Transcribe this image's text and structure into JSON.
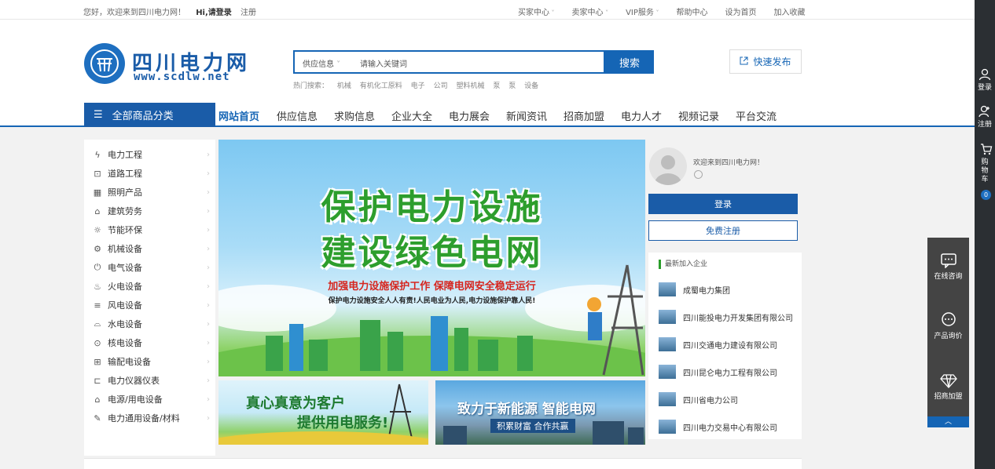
{
  "topbar": {
    "greeting": "您好，欢迎来到四川电力网！",
    "login_prompt": "Hi,请登录",
    "register": "注册",
    "links": [
      "买家中心",
      "卖家中心",
      "VIP服务",
      "帮助中心",
      "设为首页",
      "加入收藏"
    ]
  },
  "logo": {
    "name": "四川电力网",
    "url": "www.scdlw.net"
  },
  "search": {
    "category": "供应信息",
    "placeholder": "请输入关键词",
    "button": "搜索",
    "hot_label": "热门搜索：",
    "hot_terms": [
      "机械",
      "有机化工原料",
      "电子",
      "公司",
      "塑料机械",
      "泵",
      "泵",
      "设备"
    ]
  },
  "publish_button": "快速发布",
  "nav": {
    "all_categories": "全部商品分类",
    "items": [
      "网站首页",
      "供应信息",
      "求购信息",
      "企业大全",
      "电力展会",
      "新闻资讯",
      "招商加盟",
      "电力人才",
      "视频记录",
      "平台交流"
    ]
  },
  "categories": [
    "电力工程",
    "道路工程",
    "照明产品",
    "建筑劳务",
    "节能环保",
    "机械设备",
    "电气设备",
    "火电设备",
    "风电设备",
    "水电设备",
    "核电设备",
    "输配电设备",
    "电力仪器仪表",
    "电源/用电设备",
    "电力通用设备/材料"
  ],
  "banner_main": {
    "line1": "保护电力设施",
    "line2": "建设绿色电网",
    "line3": "加强电力设施保护工作 保障电网安全稳定运行",
    "line4": "保护电力设施安全人人有责!人民电业为人民,电力设施保护靠人民!"
  },
  "banner_small1": {
    "line1": "真心真意为客户",
    "line2": "提供用电服务!"
  },
  "banner_small2": {
    "line1": "致力于新能源  智能电网",
    "line2": "积累财富 合作共赢"
  },
  "user_panel": {
    "welcome": "欢迎来到四川电力网！",
    "login": "登录",
    "register": "免费注册"
  },
  "new_companies": {
    "title": "最新加入企业",
    "items": [
      "成蜀电力集团",
      "四川能投电力开发集团有限公司",
      "四川交通电力建设有限公司",
      "四川昆仑电力工程有限公司",
      "四川省电力公司",
      "四川电力交易中心有限公司"
    ]
  },
  "float_service": [
    "在线咨询",
    "产品询价",
    "招商加盟"
  ],
  "sidebar": {
    "login": "登录",
    "register": "注册",
    "cart": "购物车",
    "cart_count": "0"
  },
  "colors": {
    "primary": "#1565b5",
    "green": "#2d9e2d",
    "red": "#d6261f"
  }
}
